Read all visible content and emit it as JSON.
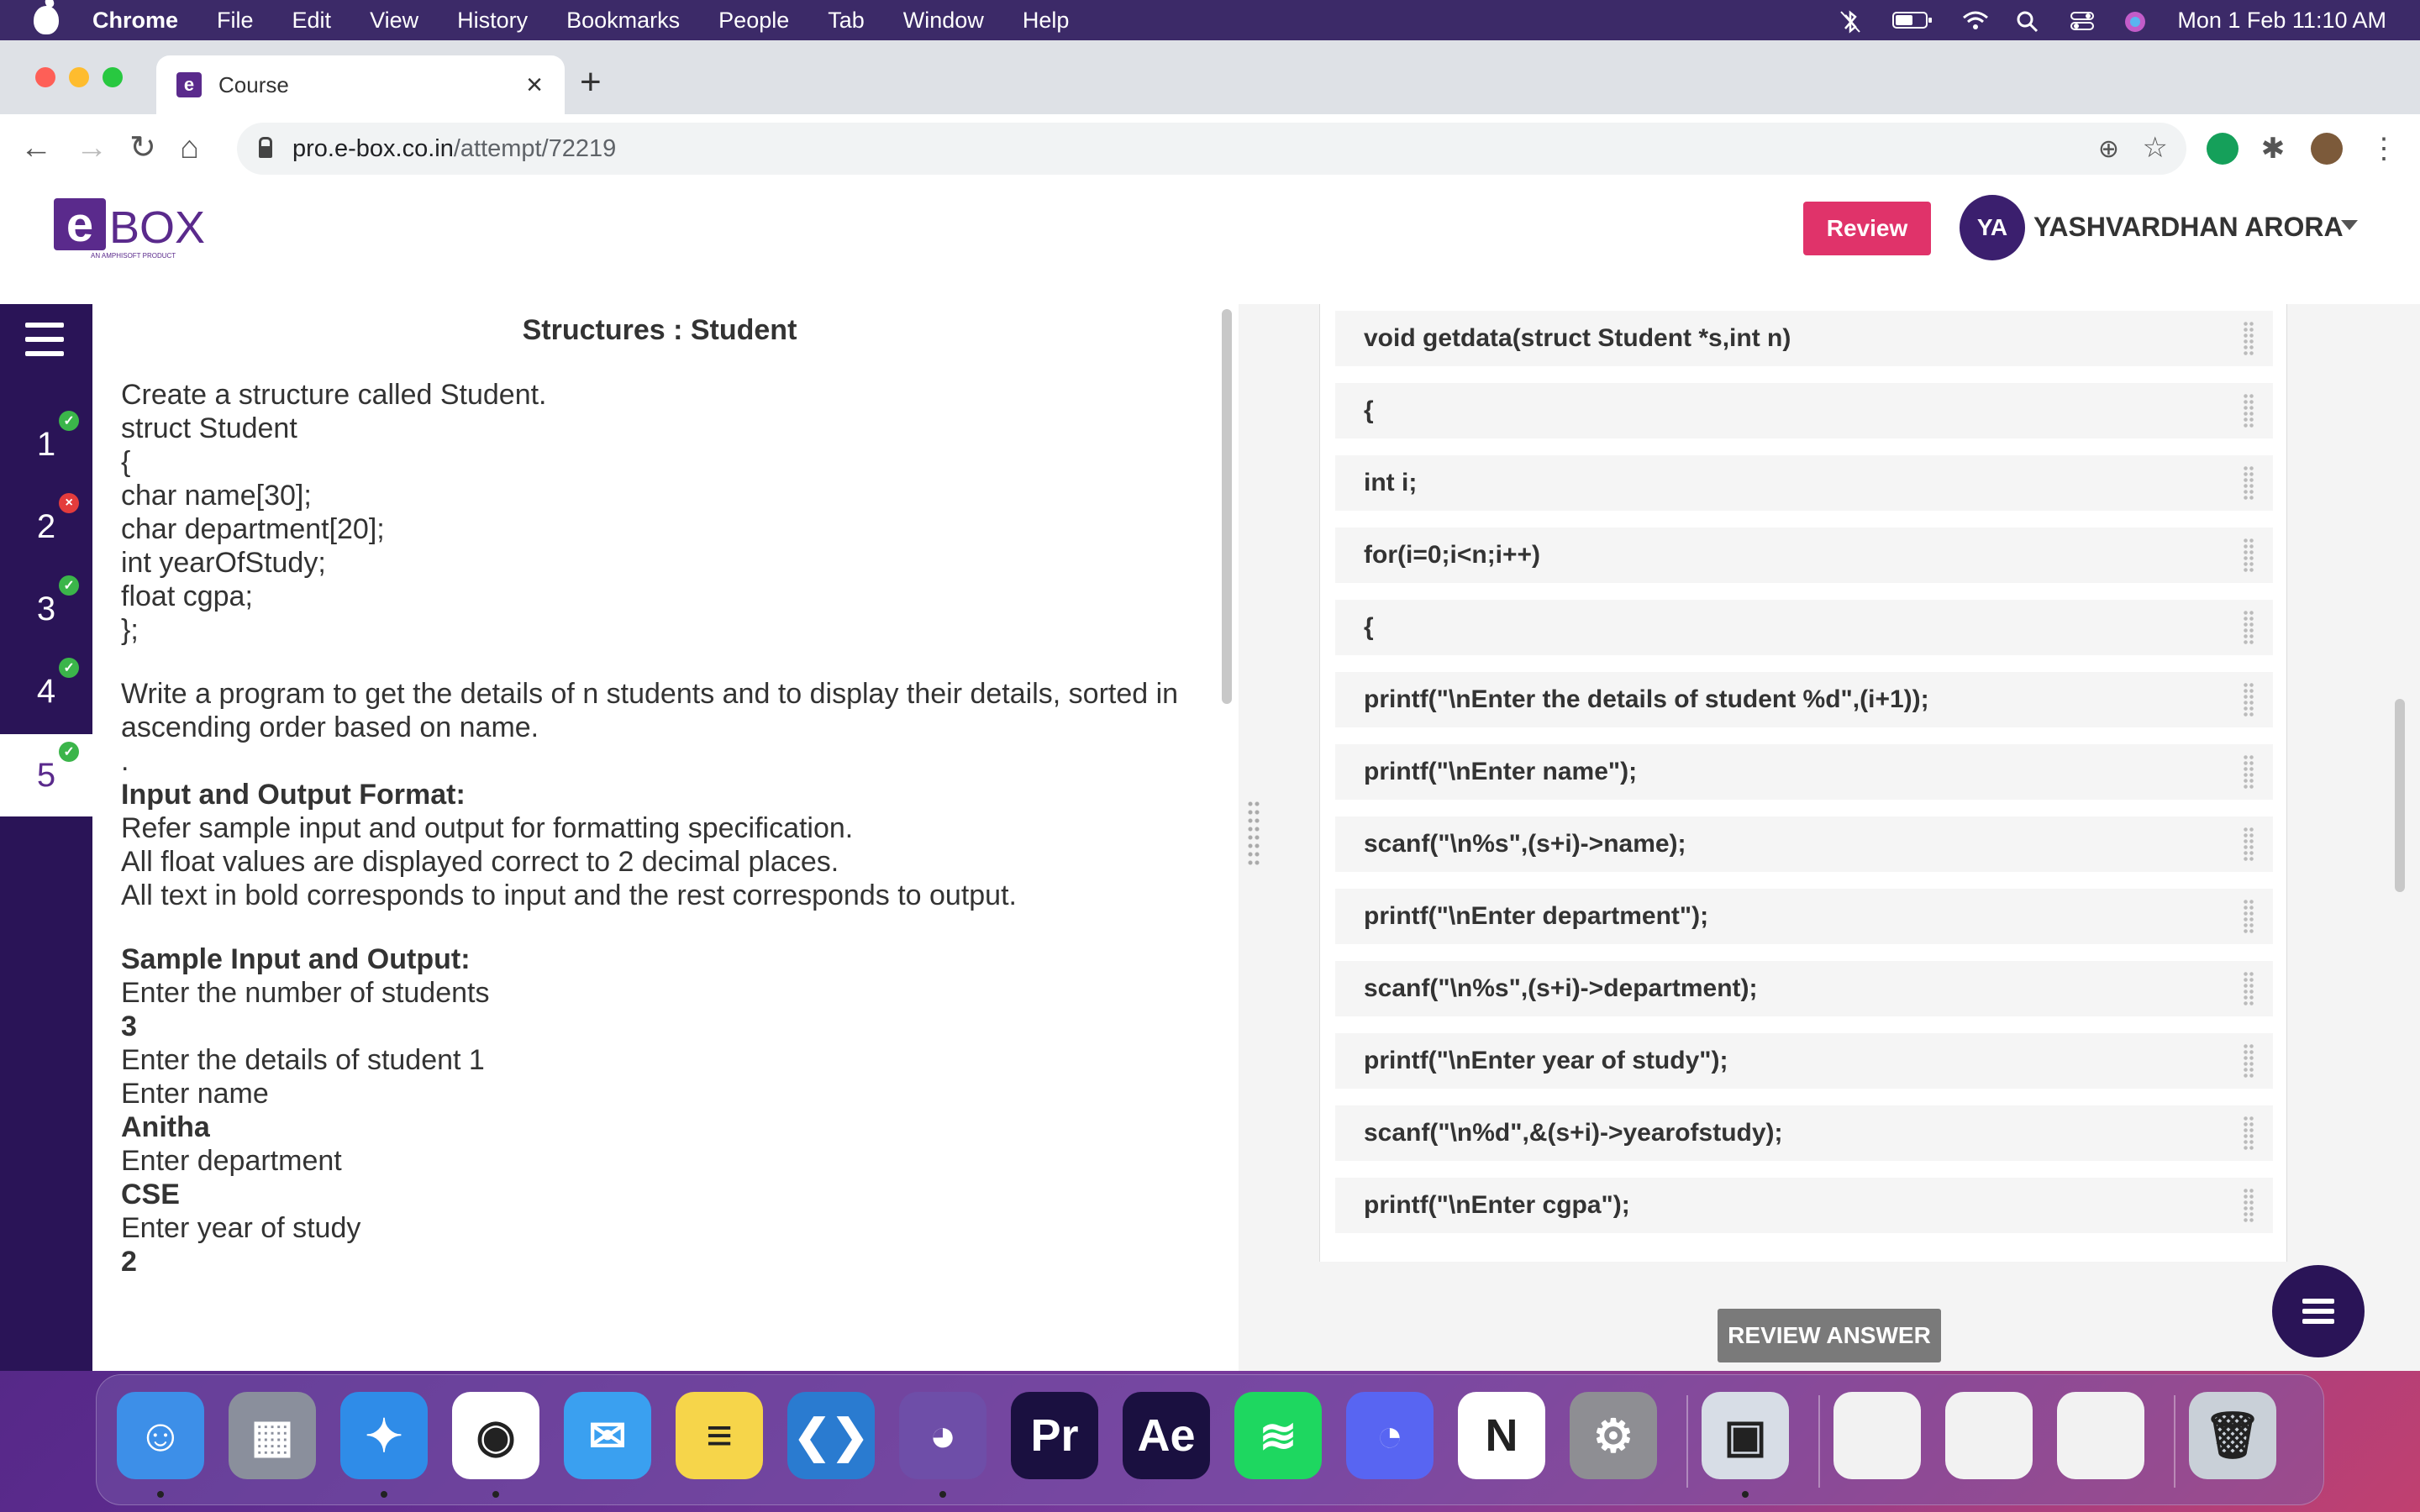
{
  "menubar": {
    "app": "Chrome",
    "items": [
      "File",
      "Edit",
      "View",
      "History",
      "Bookmarks",
      "People",
      "Tab",
      "Window",
      "Help"
    ],
    "clock": "Mon 1 Feb  11:10 AM"
  },
  "browser": {
    "tab_title": "Course",
    "url_host": "pro.e-box.co.in",
    "url_path": "/attempt/72219"
  },
  "header": {
    "logo_letter": "e",
    "logo_text": "BOX",
    "logo_tag": "AN AMPHISOFT PRODUCT",
    "review_label": "Review",
    "avatar_initials": "YA",
    "username": "YASHVARDHAN ARORA"
  },
  "sidebar": {
    "questions": [
      {
        "num": "1",
        "status": "correct"
      },
      {
        "num": "2",
        "status": "wrong"
      },
      {
        "num": "3",
        "status": "correct"
      },
      {
        "num": "4",
        "status": "correct"
      },
      {
        "num": "5",
        "status": "correct",
        "active": true
      }
    ]
  },
  "question": {
    "title": "Structures : Student",
    "lines": [
      {
        "text": "Create a structure called Student.",
        "bold": false
      },
      {
        "text": "struct Student",
        "bold": false
      },
      {
        "text": "{",
        "bold": false
      },
      {
        "text": "char name[30];",
        "bold": false
      },
      {
        "text": "char department[20];",
        "bold": false
      },
      {
        "text": "int yearOfStudy;",
        "bold": false
      },
      {
        "text": "float cgpa;",
        "bold": false
      },
      {
        "text": "};",
        "bold": false
      },
      {
        "text": "",
        "bold": false
      },
      {
        "text": "Write a program to get the details of n students and to display their details, sorted in",
        "bold": false
      },
      {
        "text": "ascending order based on name.",
        "bold": false
      },
      {
        "text": ".",
        "bold": false
      },
      {
        "text": "Input and Output Format:",
        "bold": true
      },
      {
        "text": "Refer sample input and output for formatting specification.",
        "bold": false
      },
      {
        "text": "All float values are displayed correct to 2 decimal places.",
        "bold": false
      },
      {
        "text": "All text in bold corresponds to input and the rest corresponds to output.",
        "bold": false
      },
      {
        "text": "",
        "bold": false
      },
      {
        "text": "Sample Input and Output:",
        "bold": true
      },
      {
        "text": "Enter the number of students",
        "bold": false
      },
      {
        "text": "3",
        "bold": true
      },
      {
        "text": "Enter the details of student 1",
        "bold": false
      },
      {
        "text": "Enter name",
        "bold": false
      },
      {
        "text": "Anitha",
        "bold": true
      },
      {
        "text": "Enter department",
        "bold": false
      },
      {
        "text": "CSE",
        "bold": true
      },
      {
        "text": "Enter year of study",
        "bold": false
      },
      {
        "text": "2",
        "bold": true
      }
    ]
  },
  "code_blocks": [
    "void getdata(struct Student *s,int n)",
    "{",
    "int i;",
    "for(i=0;i<n;i++)",
    "{",
    "printf(\"\\nEnter the details of student %d\",(i+1));",
    "printf(\"\\nEnter name\");",
    "scanf(\"\\n%s\",(s+i)->name);",
    "printf(\"\\nEnter department\");",
    "scanf(\"\\n%s\",(s+i)->department);",
    "printf(\"\\nEnter year of study\");",
    "scanf(\"\\n%d\",&(s+i)->yearofstudy);",
    "printf(\"\\nEnter cgpa\");"
  ],
  "review_answer_label": "REVIEW ANSWER",
  "dock": [
    {
      "name": "finder-icon",
      "color": "#3d8fe8",
      "glyph": "☺"
    },
    {
      "name": "launchpad-icon",
      "color": "#8a8f9c",
      "glyph": "▦"
    },
    {
      "name": "safari-icon",
      "color": "#2f8ce8",
      "glyph": "✦"
    },
    {
      "name": "chrome-icon",
      "color": "#ffffff",
      "glyph": "◉"
    },
    {
      "name": "mail-icon",
      "color": "#3aa0f0",
      "glyph": "✉"
    },
    {
      "name": "notes-icon",
      "color": "#f6d54a",
      "glyph": "≡"
    },
    {
      "name": "vscode-icon",
      "color": "#2a7bd0",
      "glyph": "❮❯"
    },
    {
      "name": "github-desktop-icon",
      "color": "#6e4ea8",
      "glyph": "◕"
    },
    {
      "name": "premiere-icon",
      "color": "#1a1040",
      "glyph": "Pr"
    },
    {
      "name": "after-effects-icon",
      "color": "#1a1040",
      "glyph": "Ae"
    },
    {
      "name": "spotify-icon",
      "color": "#1ed760",
      "glyph": "≋"
    },
    {
      "name": "discord-icon",
      "color": "#5865f2",
      "glyph": "◔"
    },
    {
      "name": "notion-icon",
      "color": "#ffffff",
      "glyph": "N"
    },
    {
      "name": "system-preferences-icon",
      "color": "#8e8e93",
      "glyph": "⚙"
    },
    {
      "name": "preview-icon",
      "color": "#d7dde6",
      "glyph": "▣"
    },
    {
      "name": "recent-window-1-icon",
      "color": "#f2f2f2",
      "glyph": ""
    },
    {
      "name": "recent-window-2-icon",
      "color": "#f2f2f2",
      "glyph": ""
    },
    {
      "name": "recent-window-3-icon",
      "color": "#f2f2f2",
      "glyph": ""
    },
    {
      "name": "trash-icon",
      "color": "#c9d0d8",
      "glyph": "🗑"
    }
  ],
  "colors": {
    "brand_purple": "#5a2a8c",
    "sidebar_dark": "#2a1457",
    "review_pink": "#e0336a",
    "correct_green": "#3bb54a",
    "wrong_red": "#e43c3c"
  }
}
